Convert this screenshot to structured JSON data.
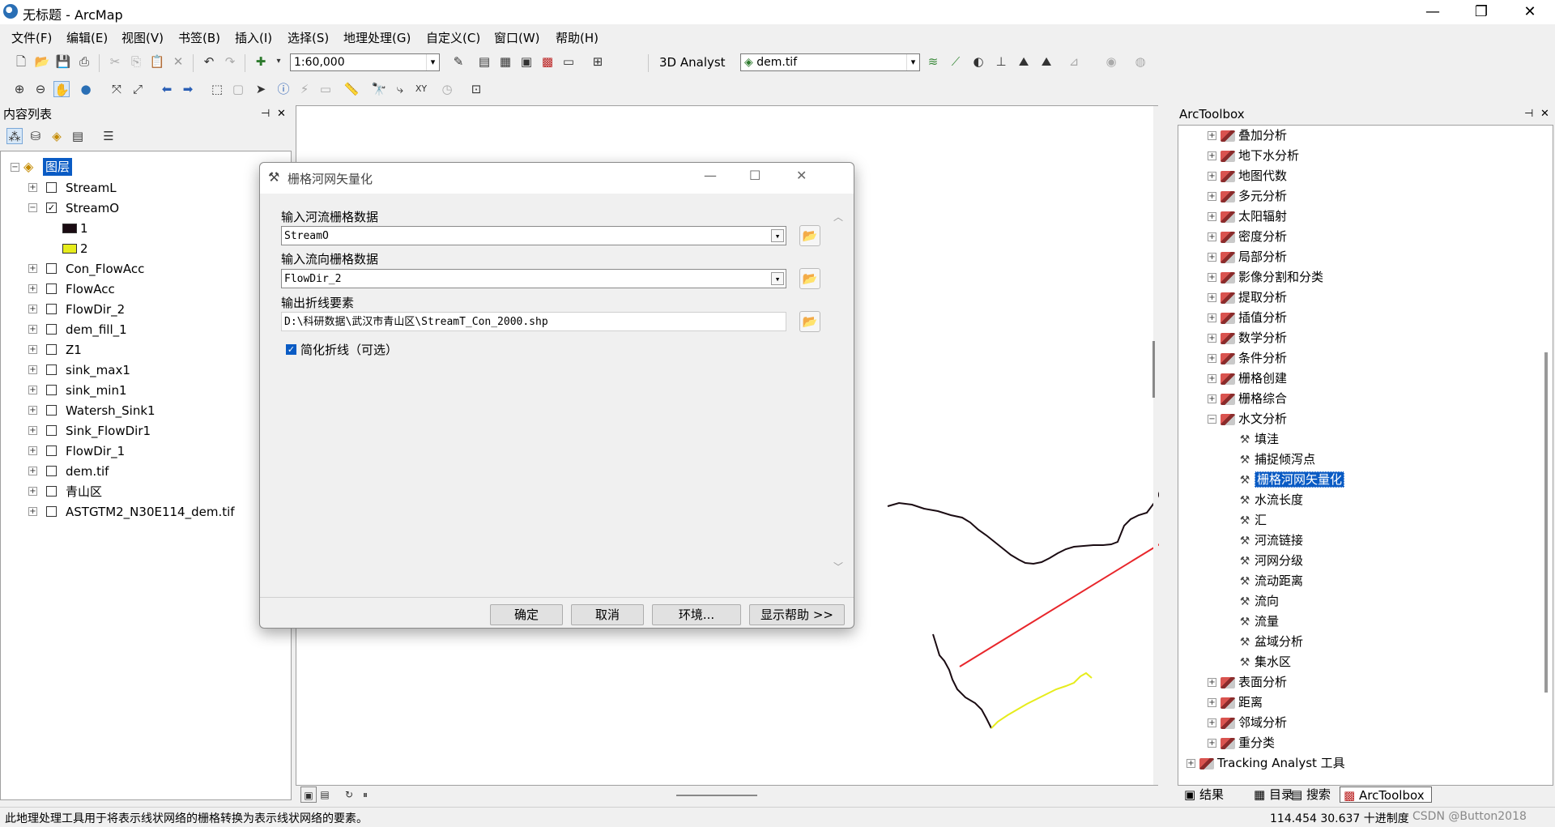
{
  "window": {
    "title": "无标题 - ArcMap",
    "minimize": "—",
    "maximize": "❐",
    "close": "✕"
  },
  "menu": [
    "文件(F)",
    "编辑(E)",
    "视图(V)",
    "书签(B)",
    "插入(I)",
    "选择(S)",
    "地理处理(G)",
    "自定义(C)",
    "窗口(W)",
    "帮助(H)"
  ],
  "toolbar": {
    "scale": "1:60,000",
    "analyst_label": "3D Analyst",
    "layer_combo": "dem.tif"
  },
  "toc": {
    "title": "内容列表",
    "root": "图层",
    "layers": [
      {
        "name": "StreamL",
        "checked": false,
        "expanded": false
      },
      {
        "name": "StreamO",
        "checked": true,
        "expanded": true
      },
      {
        "name": "Con_FlowAcc",
        "checked": false,
        "expanded": false
      },
      {
        "name": "FlowAcc",
        "checked": false,
        "expanded": false
      },
      {
        "name": "FlowDir_2",
        "checked": false,
        "expanded": false
      },
      {
        "name": "dem_fill_1",
        "checked": false,
        "expanded": false
      },
      {
        "name": "Z1",
        "checked": false,
        "expanded": false
      },
      {
        "name": "sink_max1",
        "checked": false,
        "expanded": false
      },
      {
        "name": "sink_min1",
        "checked": false,
        "expanded": false
      },
      {
        "name": "Watersh_Sink1",
        "checked": false,
        "expanded": false
      },
      {
        "name": "Sink_FlowDir1",
        "checked": false,
        "expanded": false
      },
      {
        "name": "FlowDir_1",
        "checked": false,
        "expanded": false
      },
      {
        "name": "dem.tif",
        "checked": false,
        "expanded": false
      },
      {
        "name": "青山区",
        "checked": false,
        "expanded": false
      },
      {
        "name": "ASTGTM2_N30E114_dem.tif",
        "checked": false,
        "expanded": false
      }
    ],
    "legend": [
      {
        "label": "1",
        "color": "#1a0b12"
      },
      {
        "label": "2",
        "color": "#e6ec1c"
      }
    ]
  },
  "dialog": {
    "title": "栅格河网矢量化",
    "input_stream_label": "输入河流栅格数据",
    "input_stream_value": "StreamO",
    "input_flowdir_label": "输入流向栅格数据",
    "input_flowdir_value": "FlowDir_2",
    "output_label": "输出折线要素",
    "output_value": "D:\\科研数据\\武汉市青山区\\StreamT_Con_2000.shp",
    "simplify_label": "简化折线（可选）",
    "simplify_checked": true,
    "buttons": {
      "ok": "确定",
      "cancel": "取消",
      "env": "环境...",
      "help": "显示帮助 >>"
    }
  },
  "toolbox": {
    "title": "ArcToolbox",
    "items": [
      {
        "label": "叠加分析",
        "type": "toolset"
      },
      {
        "label": "地下水分析",
        "type": "toolset"
      },
      {
        "label": "地图代数",
        "type": "toolset"
      },
      {
        "label": "多元分析",
        "type": "toolset"
      },
      {
        "label": "太阳辐射",
        "type": "toolset"
      },
      {
        "label": "密度分析",
        "type": "toolset"
      },
      {
        "label": "局部分析",
        "type": "toolset"
      },
      {
        "label": "影像分割和分类",
        "type": "toolset"
      },
      {
        "label": "提取分析",
        "type": "toolset"
      },
      {
        "label": "插值分析",
        "type": "toolset"
      },
      {
        "label": "数学分析",
        "type": "toolset"
      },
      {
        "label": "条件分析",
        "type": "toolset"
      },
      {
        "label": "栅格创建",
        "type": "toolset"
      },
      {
        "label": "栅格综合",
        "type": "toolset"
      },
      {
        "label": "水文分析",
        "type": "open"
      },
      {
        "label": "填洼",
        "type": "tool"
      },
      {
        "label": "捕捉倾泻点",
        "type": "tool"
      },
      {
        "label": "栅格河网矢量化",
        "type": "tool",
        "selected": true
      },
      {
        "label": "水流长度",
        "type": "tool"
      },
      {
        "label": "汇",
        "type": "tool"
      },
      {
        "label": "河流链接",
        "type": "tool"
      },
      {
        "label": "河网分级",
        "type": "tool"
      },
      {
        "label": "流动距离",
        "type": "tool"
      },
      {
        "label": "流向",
        "type": "tool"
      },
      {
        "label": "流量",
        "type": "tool"
      },
      {
        "label": "盆域分析",
        "type": "tool"
      },
      {
        "label": "集水区",
        "type": "tool"
      },
      {
        "label": "表面分析",
        "type": "toolset"
      },
      {
        "label": "距离",
        "type": "toolset"
      },
      {
        "label": "邻域分析",
        "type": "toolset"
      },
      {
        "label": "重分类",
        "type": "toolset"
      },
      {
        "label": "Tracking Analyst 工具",
        "type": "box"
      }
    ],
    "tabs": [
      "结果",
      "目录",
      "搜索",
      "ArcToolbox"
    ]
  },
  "status": {
    "message": "此地理处理工具用于将表示线状网络的栅格转换为表示线状网络的要素。",
    "coords": "114.454  30.637 十进制度",
    "watermark": "CSDN @Button2018"
  },
  "colors": {
    "selection": "#0a5bc4",
    "arrow": "#e8262b",
    "stream_dark": "#1a0b12",
    "stream_yellow": "#e6ec1c"
  }
}
